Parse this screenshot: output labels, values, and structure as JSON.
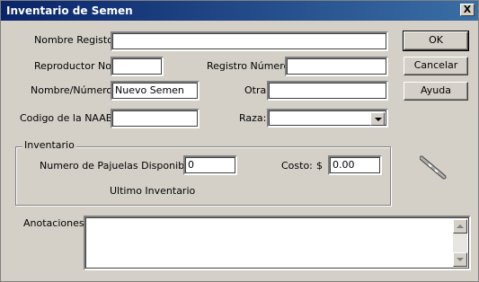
{
  "window": {
    "title": "Inventario de Semen",
    "close_label": "X"
  },
  "form": {
    "nombre_registro": {
      "label": "Nombre Registo:",
      "value": ""
    },
    "reproductor_no": {
      "label": "Reproductor No.",
      "value": ""
    },
    "registro_numero": {
      "label": "Registro Número:",
      "value": ""
    },
    "nombre_numero": {
      "label": "Nombre/Número:",
      "value": "Nuevo Semen"
    },
    "otra": {
      "label": "Otra",
      "value": ""
    },
    "codigo_naab": {
      "label": "Codigo de la NAAB:",
      "value": ""
    },
    "raza": {
      "label": "Raza:",
      "value": ""
    }
  },
  "buttons": {
    "ok": "OK",
    "cancelar": "Cancelar",
    "ayuda": "Ayuda"
  },
  "inventario": {
    "title": "Inventario",
    "pajuelas_label": "Numero de Pajuelas Disponibles:",
    "pajuelas_value": "0",
    "costo_label": "Costo:",
    "currency": "$",
    "costo_value": "0.00",
    "ultimo_label": "Ultimo Inventario"
  },
  "anotaciones": {
    "label": "Anotaciones:",
    "value": ""
  },
  "icons": {
    "close": "close-icon",
    "dropdown": "chevron-down-icon",
    "straw": "semen-straw-icon"
  },
  "colors": {
    "titlebar_start": "#0a246a",
    "titlebar_end": "#3a6ea5",
    "face": "#d4d0c8"
  }
}
